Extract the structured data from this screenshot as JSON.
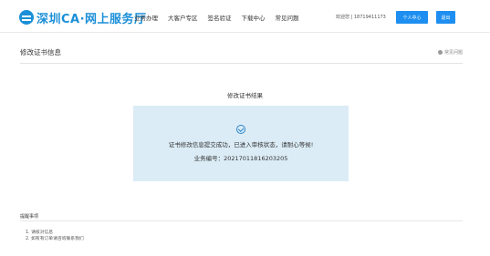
{
  "header": {
    "logo_text": "深圳CA·网上服务厅",
    "nav": [
      "业务办理",
      "大客户专区",
      "签名验证",
      "下载中心",
      "常见问题"
    ],
    "hotline": "欢迎您 | 18719411173",
    "user_center_label": "个人中心",
    "logout_label": "退出"
  },
  "page": {
    "title": "修改证书信息",
    "help_label": "常见问题"
  },
  "result": {
    "title": "修改证书结果",
    "message": "证书修改信息提交成功，已进入审核状态，请耐心等候!",
    "business_no": "业务编号：20217011816203205"
  },
  "notes": {
    "title": "提醒事项",
    "items": [
      "1. 请核对信息",
      "2. 如有有订单请咨询联系我们"
    ]
  },
  "colors": {
    "brand": "#1b8fd8",
    "button": "#1e8ff0",
    "result_bg": "#dbecf6"
  }
}
